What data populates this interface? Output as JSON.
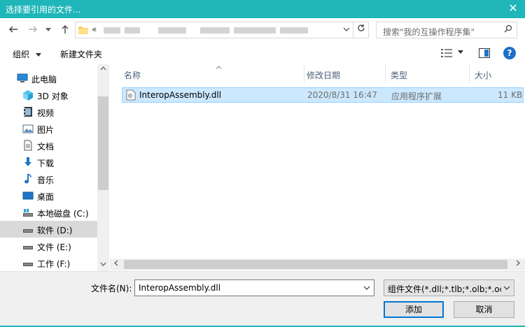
{
  "window": {
    "title": "选择要引用的文件...",
    "close_glyph": "✕",
    "accent_color": "#1fb6b9"
  },
  "address": {
    "prefix": "«",
    "search_placeholder": "搜索\"我的互操作程序集\""
  },
  "toolbar": {
    "organize_label": "组织",
    "new_folder_label": "新建文件夹"
  },
  "nav": {
    "items": [
      {
        "label": "此电脑",
        "icon": "computer-icon"
      },
      {
        "label": "3D 对象",
        "icon": "cube-3d-icon"
      },
      {
        "label": "视频",
        "icon": "video-icon"
      },
      {
        "label": "图片",
        "icon": "picture-icon"
      },
      {
        "label": "文档",
        "icon": "document-icon"
      },
      {
        "label": "下载",
        "icon": "download-icon"
      },
      {
        "label": "音乐",
        "icon": "music-icon"
      },
      {
        "label": "桌面",
        "icon": "desktop-icon"
      },
      {
        "label": "本地磁盘 (C:)",
        "icon": "drive-c-icon"
      },
      {
        "label": "软件 (D:)",
        "icon": "drive-icon",
        "selected": true
      },
      {
        "label": "文件 (E:)",
        "icon": "drive-icon"
      },
      {
        "label": "工作 (F:)",
        "icon": "drive-icon"
      }
    ]
  },
  "filelist": {
    "columns": [
      "名称",
      "修改日期",
      "类型",
      "大小"
    ],
    "rows": [
      {
        "name": "InteropAssembly.dll",
        "modified": "2020/8/31 16:47",
        "type": "应用程序扩展",
        "size": "11 KB"
      }
    ]
  },
  "footer": {
    "filename_label": "文件名(N):",
    "filename_value": "InteropAssembly.dll",
    "filter_value": "组件文件(*.dll;*.tlb;*.olb;*.ocx;",
    "ok_label": "添加",
    "cancel_label": "取消"
  }
}
